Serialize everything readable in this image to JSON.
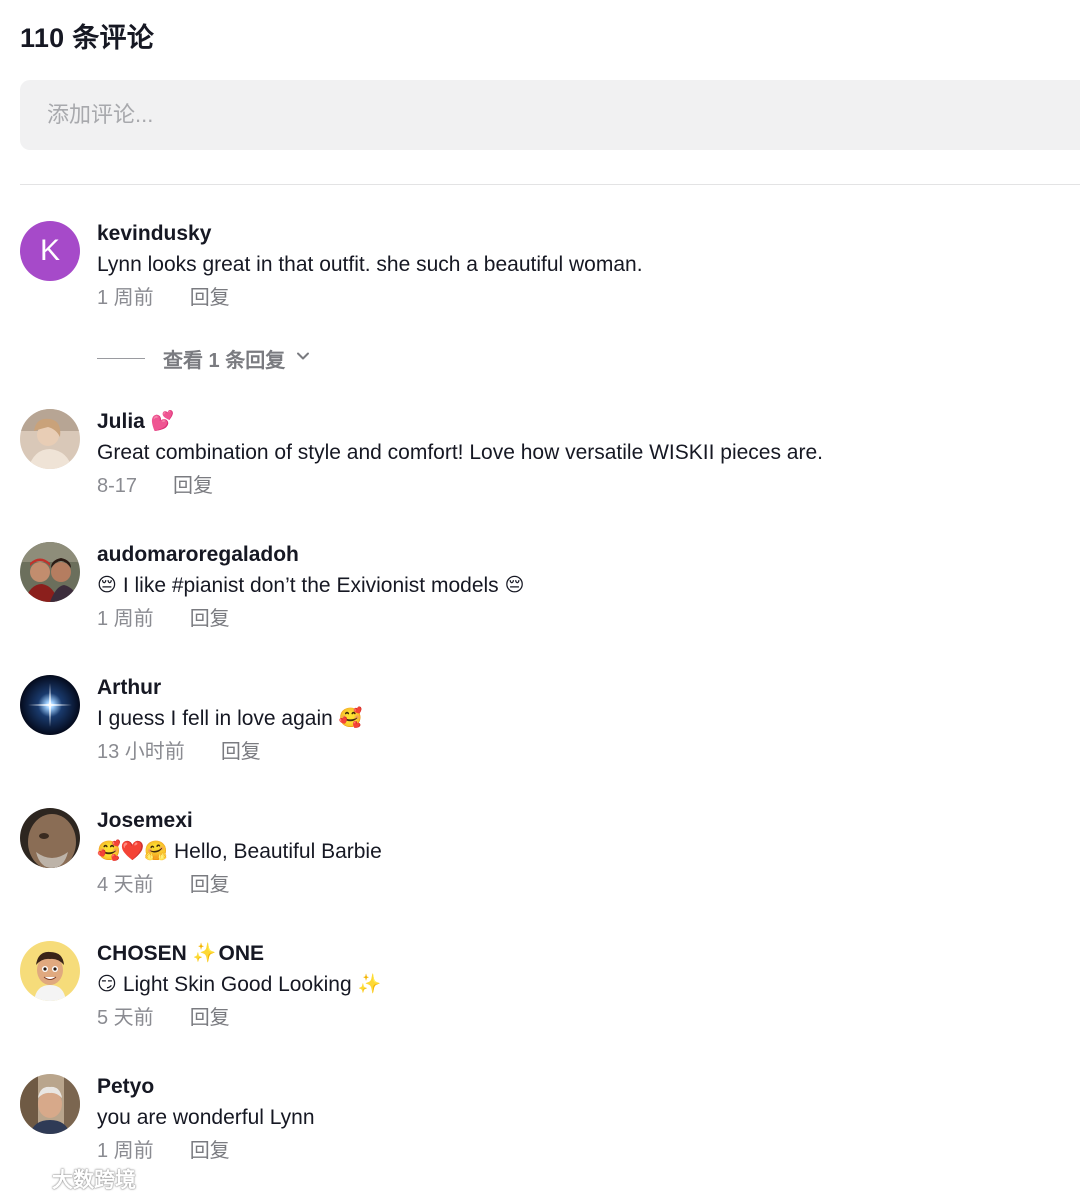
{
  "header": {
    "title": "110 条评论"
  },
  "input": {
    "placeholder": "添加评论..."
  },
  "comments": [
    {
      "username": "kevindusky",
      "avatar_letter": "K",
      "text": "Lynn looks great in that outfit. she such a beautiful woman.",
      "time": "1 周前",
      "reply": "回复",
      "view_replies": "查看 1 条回复"
    },
    {
      "username": "Julia",
      "name_emoji": "💕",
      "text": "Great combination of style and comfort! Love how versatile WISKII pieces are.",
      "time": "8-17",
      "reply": "回复"
    },
    {
      "username": "audomaroregaladoh",
      "text_prefix_emoji": "😔",
      "text": "I like #pianist don’t the Exivionist models",
      "text_suffix_emoji": "😔",
      "time": "1 周前",
      "reply": "回复"
    },
    {
      "username": "Arthur",
      "text": "I guess I fell in love again",
      "text_suffix_emoji": "🥰",
      "time": "13 小时前",
      "reply": "回复"
    },
    {
      "username": "Josemexi",
      "text_prefix_emoji": "🥰❤️🤗",
      "text": "Hello, Beautiful Barbie",
      "time": "4 天前",
      "reply": "回复"
    },
    {
      "username_part1": "CHOSEN",
      "name_emoji": "✨",
      "username_part2": "ONE",
      "text_prefix_emoji": "😏",
      "text": "Light Skin Good Looking",
      "text_suffix_emoji": "✨",
      "time": "5 天前",
      "reply": "回复"
    },
    {
      "username": "Petyo",
      "text": "you are wonderful Lynn",
      "time": "1 周前",
      "reply": "回复"
    }
  ],
  "watermark": "大数跨境",
  "colors": {
    "avatar_k": "#a64ac9",
    "meta": "#8a8b91",
    "input_bg": "#f1f1f2"
  }
}
